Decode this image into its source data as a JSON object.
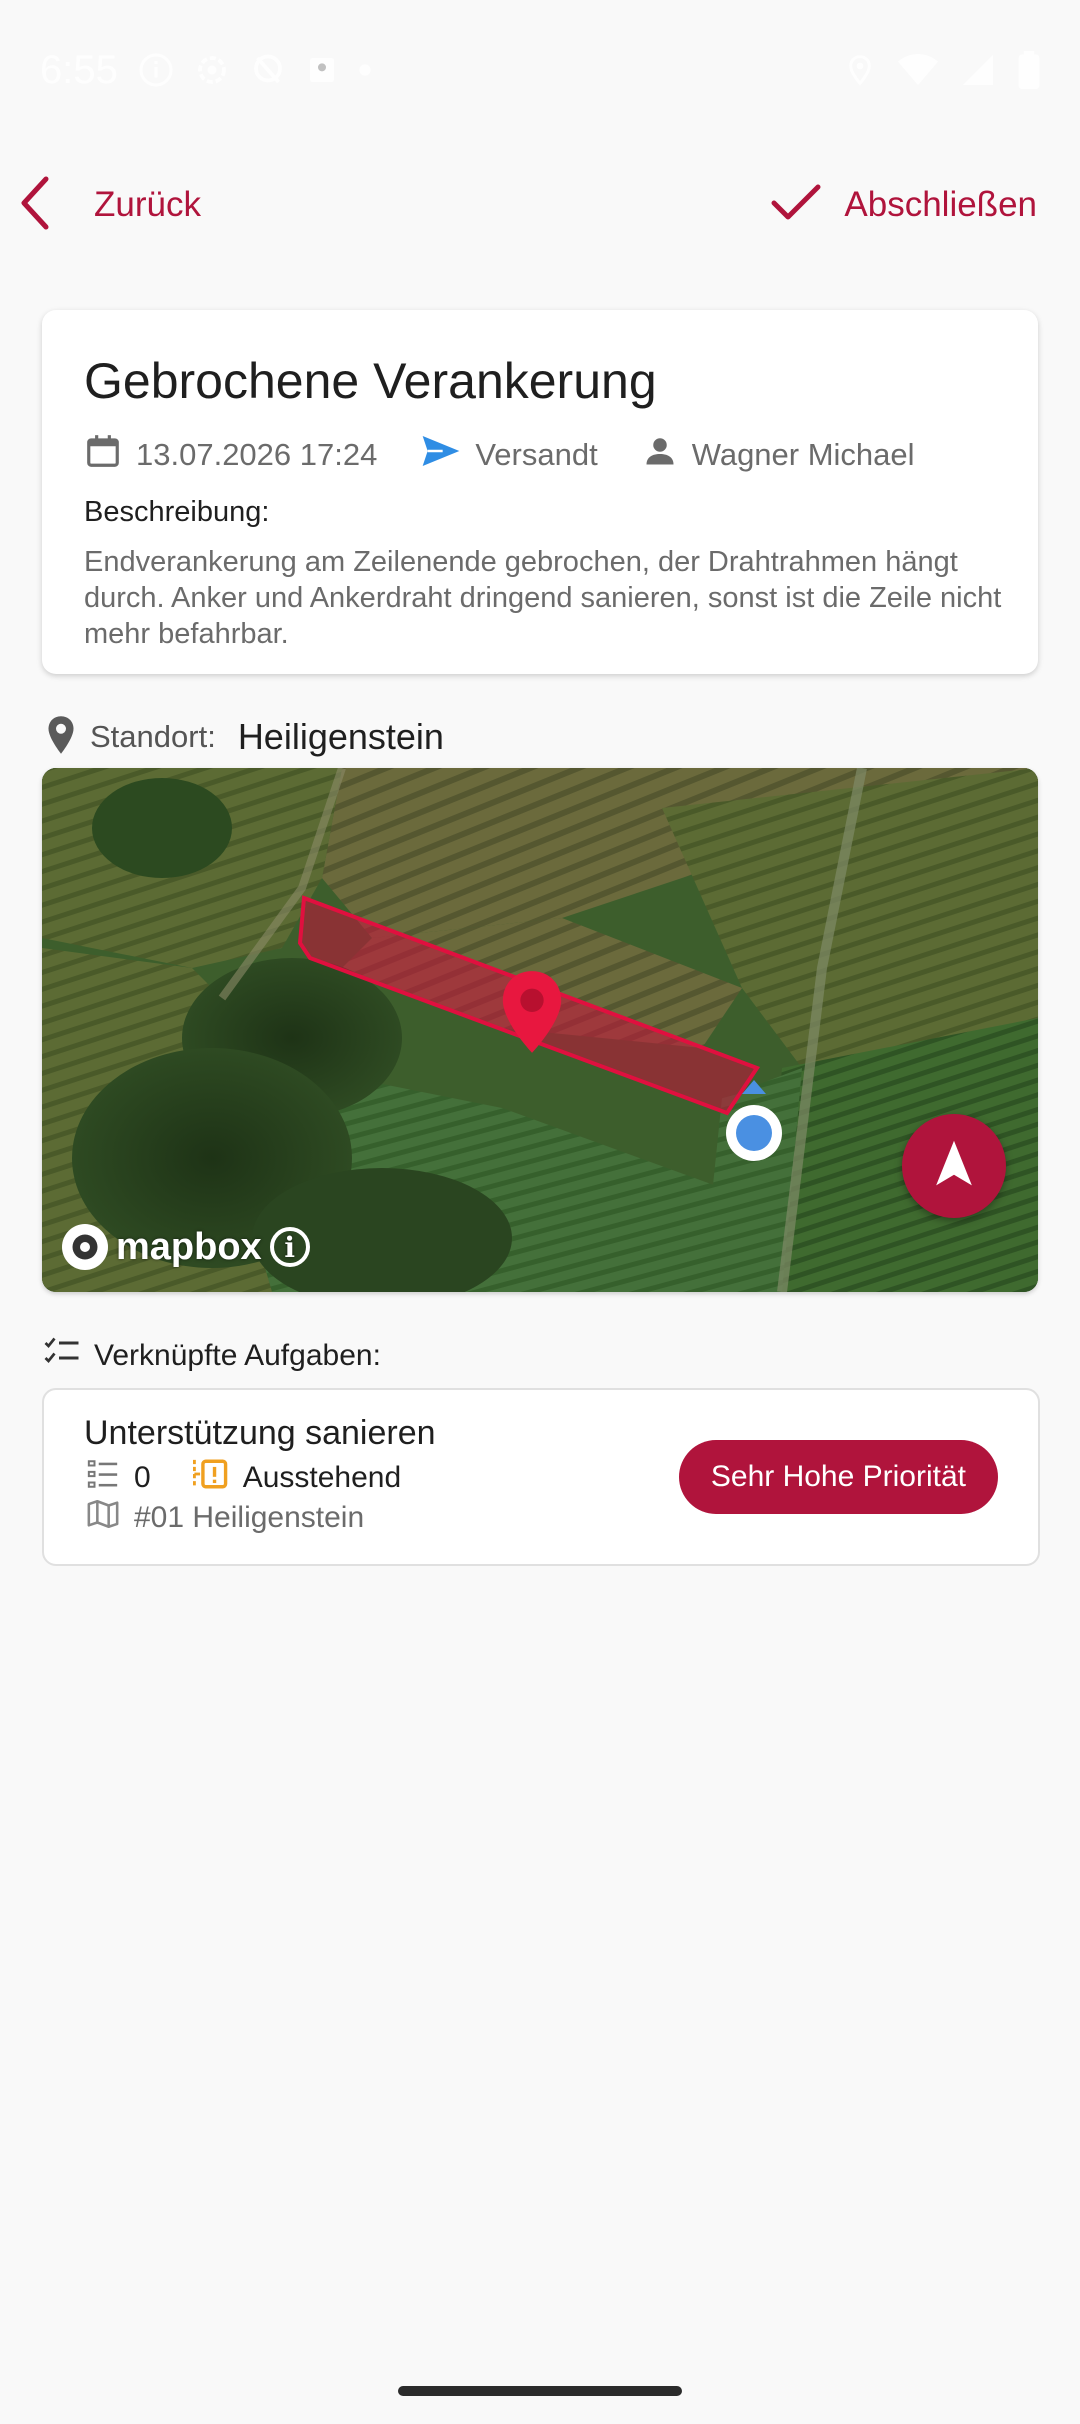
{
  "status_bar": {
    "time": "6:55",
    "left_icons": [
      "info-icon",
      "settings-sync-icon",
      "location-off-icon",
      "contact-icon",
      "dot-icon"
    ],
    "right_icons": [
      "location-icon",
      "wifi-icon",
      "signal-icon",
      "battery-icon"
    ]
  },
  "topbar": {
    "back_label": "Zurück",
    "finish_label": "Abschließen",
    "accent_color": "#b0143c"
  },
  "report": {
    "title": "Gebrochene Verankerung",
    "date": "13.07.2026 17:24",
    "status": "Versandt",
    "author": "Wagner Michael",
    "description_label": "Beschreibung:",
    "description": "Endverankerung am Zeilenende gebrochen, der Drahtrahmen hängt durch. Anker und Ankerdraht dringend sanieren, sonst ist die Zeile nicht mehr befahrbar."
  },
  "location": {
    "label": "Standort:",
    "value": "Heiligenstein"
  },
  "map": {
    "attribution": "mapbox",
    "info_glyph": "i",
    "marker_color": "#e8173f",
    "user_dot_color": "#4a90e2"
  },
  "linked_tasks": {
    "header": "Verknüpfte Aufgaben:",
    "items": [
      {
        "title": "Unterstützung sanieren",
        "count": "0",
        "status": "Ausstehend",
        "location": "#01 Heiligenstein",
        "priority": "Sehr Hohe Priorität"
      }
    ]
  }
}
